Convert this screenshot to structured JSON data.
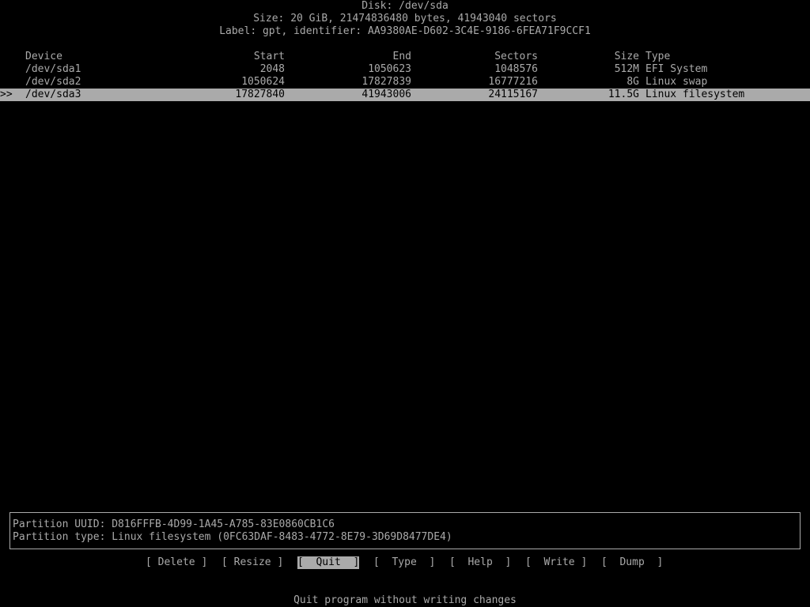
{
  "header": {
    "disk_line": "Disk: /dev/sda",
    "size_line": "Size: 20 GiB, 21474836480 bytes, 41943040 sectors",
    "label_line": "Label: gpt, identifier: AA9380AE-D602-3C4E-9186-6FEA71F9CCF1"
  },
  "table": {
    "columns": {
      "device": "Device",
      "start": "Start",
      "end": "End",
      "sectors": "Sectors",
      "size": "Size",
      "type": "Type"
    },
    "rows": [
      {
        "marker": "",
        "device": "/dev/sda1",
        "start": "2048",
        "end": "1050623",
        "sectors": "1048576",
        "size": "512M",
        "type": "EFI System"
      },
      {
        "marker": "",
        "device": "/dev/sda2",
        "start": "1050624",
        "end": "17827839",
        "sectors": "16777216",
        "size": "8G",
        "type": "Linux swap"
      },
      {
        "marker": ">>",
        "device": "/dev/sda3",
        "start": "17827840",
        "end": "41943006",
        "sectors": "24115167",
        "size": "11.5G",
        "type": "Linux filesystem"
      }
    ],
    "selected_index": 2
  },
  "info": {
    "uuid_line": "Partition UUID: D816FFFB-4D99-1A45-A785-83E0860CB1C6",
    "type_line": "Partition type: Linux filesystem (0FC63DAF-8483-4772-8E79-3D69D8477DE4)"
  },
  "menu": {
    "items": [
      {
        "label": "[ Delete ]"
      },
      {
        "label": "[ Resize ]"
      },
      {
        "label": "[  Quit  ]"
      },
      {
        "label": "[  Type  ]"
      },
      {
        "label": "[  Help  ]"
      },
      {
        "label": "[  Write ]"
      },
      {
        "label": "[  Dump  ]"
      }
    ],
    "active_index": 2
  },
  "status": {
    "message": "Quit program without writing changes"
  },
  "colors": {
    "background": "#000000",
    "foreground": "#aaaaaa",
    "highlight": "#aaaaaa"
  }
}
